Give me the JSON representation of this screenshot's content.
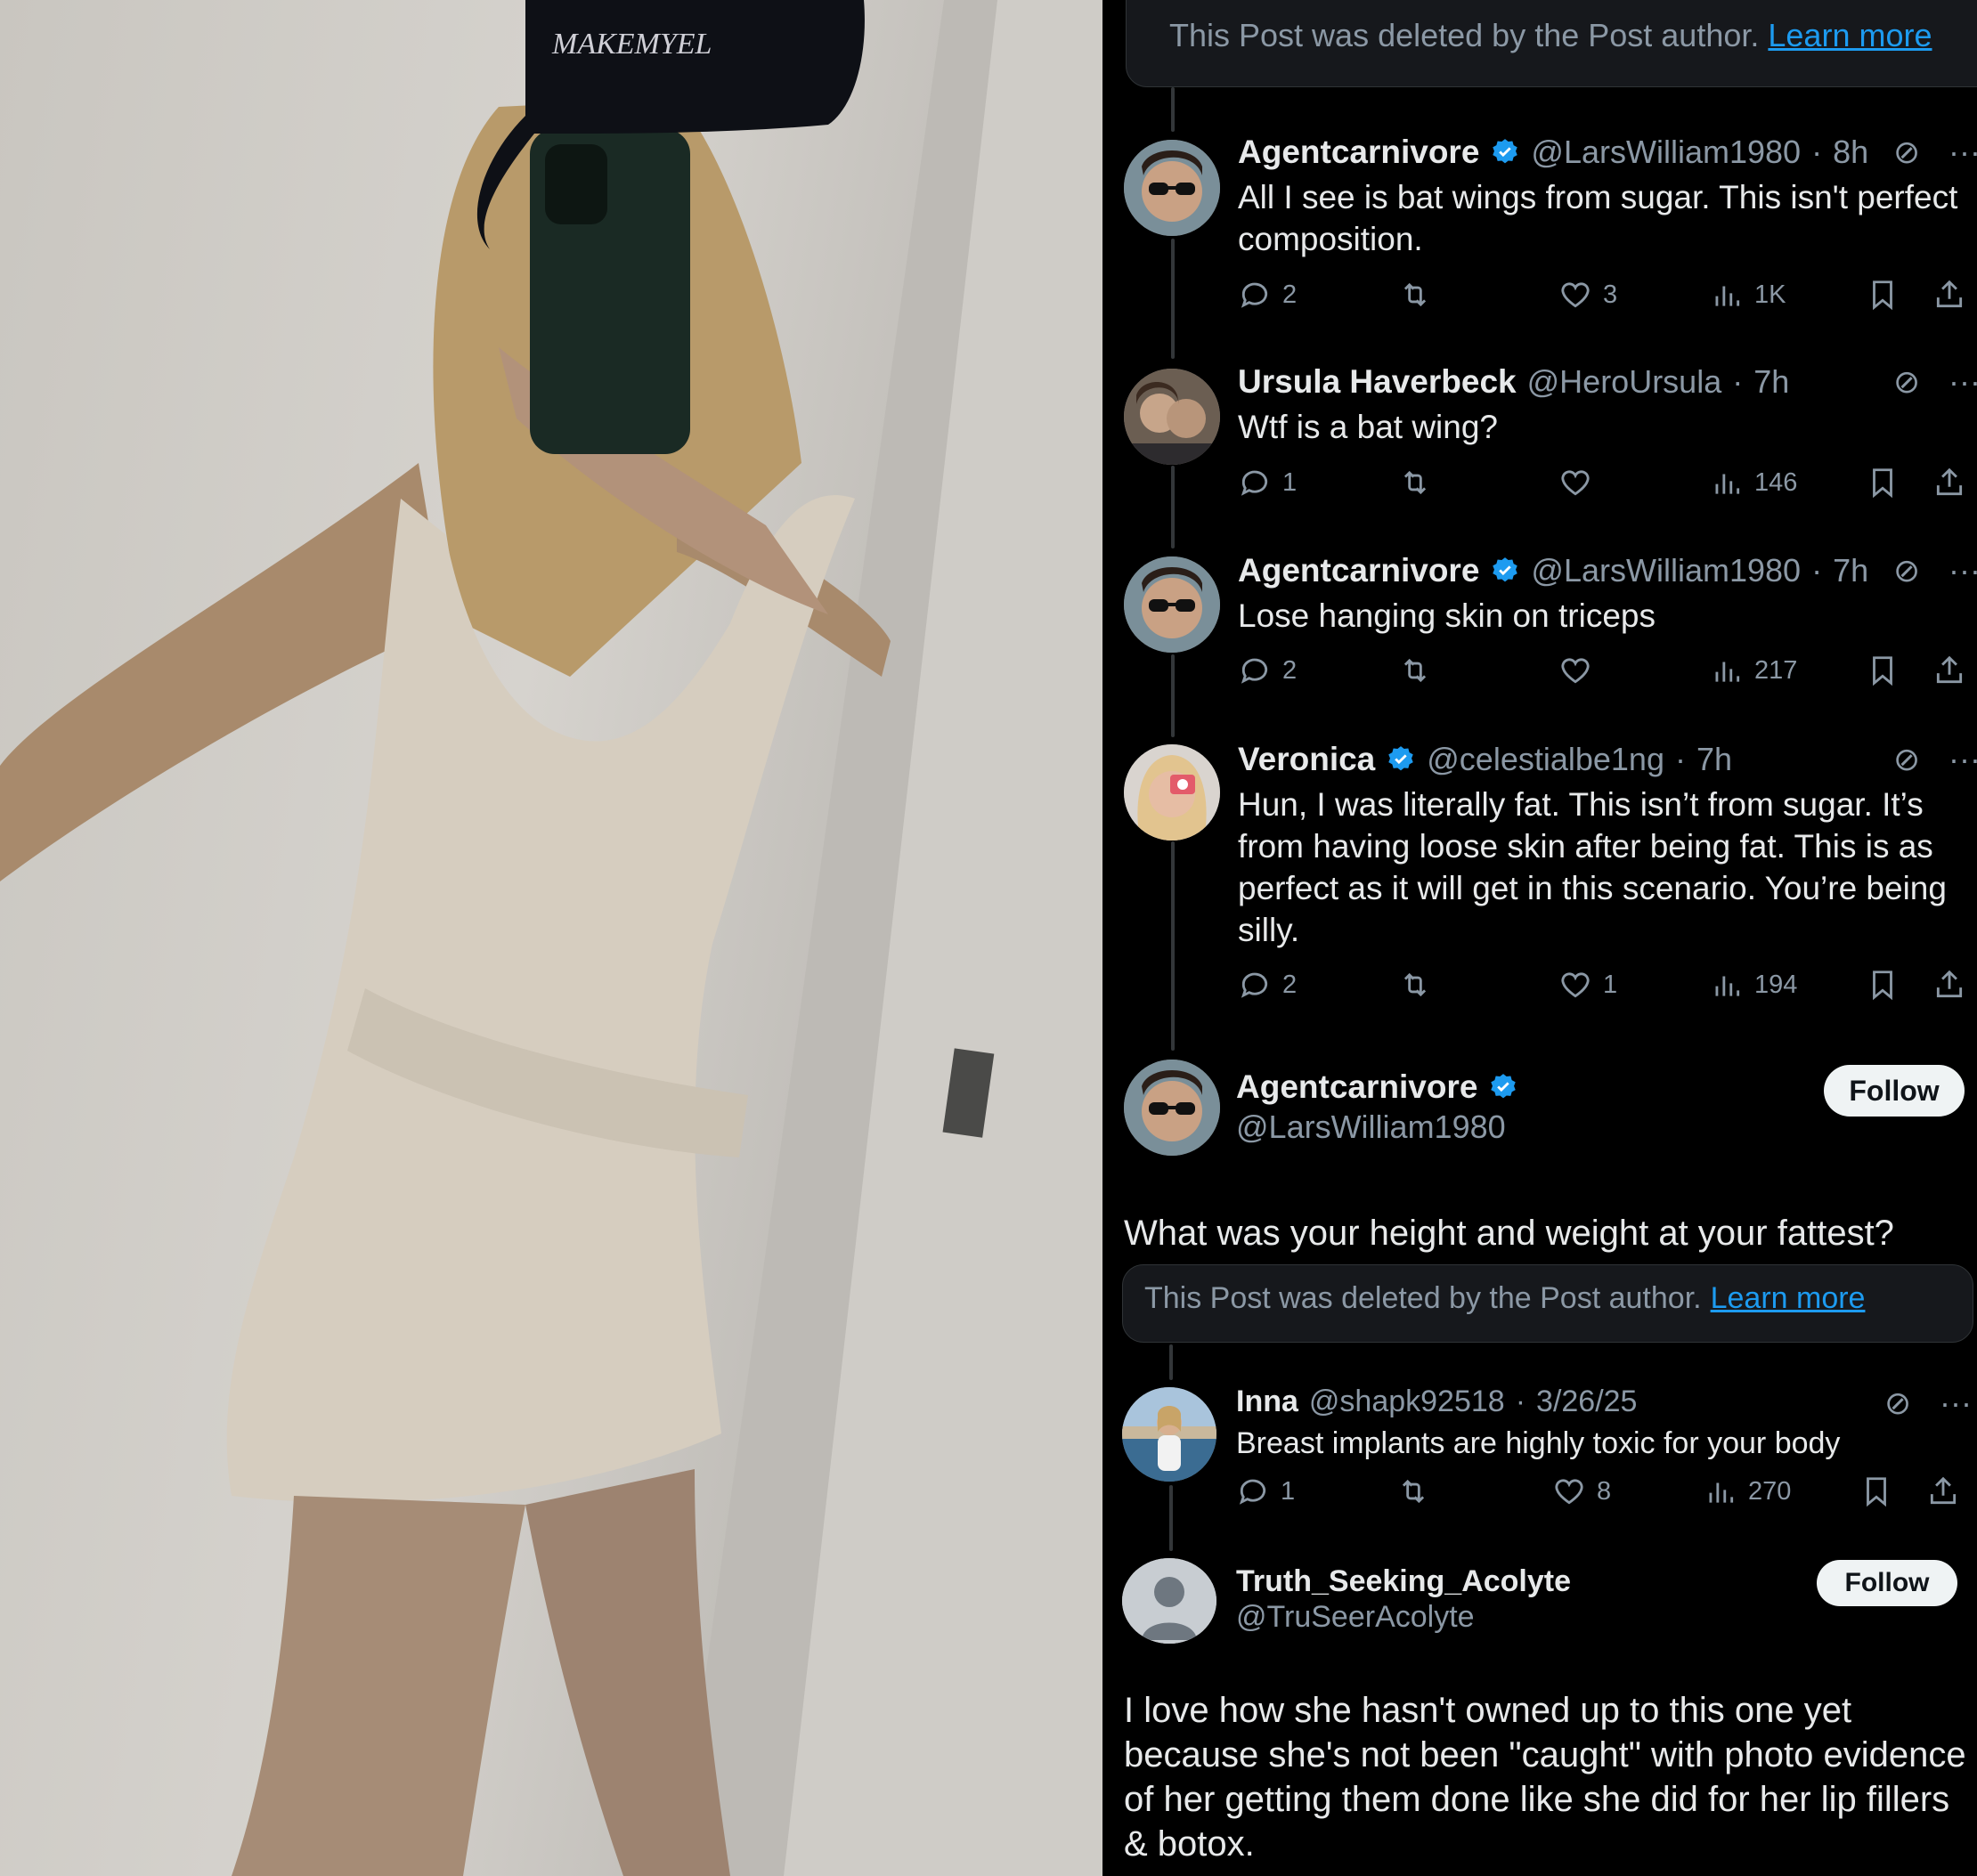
{
  "thread": {
    "deleted_notice_1": {
      "text": "This Post was deleted by the Post author.",
      "link": "Learn more"
    },
    "replies": [
      {
        "name": "Agentcarnivore",
        "handle": "@LarsWilliam1980",
        "time": "8h",
        "verified": true,
        "text": "All I see is bat wings from sugar. This isn't perfect composition.",
        "replies": "2",
        "reposts": "",
        "likes": "3",
        "views": "1K"
      },
      {
        "name": "Ursula Haverbeck",
        "handle": "@HeroUrsula",
        "time": "7h",
        "verified": false,
        "text": "Wtf is a bat wing?",
        "replies": "1",
        "reposts": "",
        "likes": "",
        "views": "146"
      },
      {
        "name": "Agentcarnivore",
        "handle": "@LarsWilliam1980",
        "time": "7h",
        "verified": true,
        "text": "Lose hanging skin on triceps",
        "replies": "2",
        "reposts": "",
        "likes": "",
        "views": "217"
      },
      {
        "name": "Veronica",
        "handle": "@celestialbe1ng",
        "time": "7h",
        "verified": true,
        "text": "Hun, I was literally fat. This isn’t from sugar. It’s from having loose skin after being fat. This is as perfect as it will get in this scenario. You’re being silly.",
        "replies": "2",
        "reposts": "",
        "likes": "1",
        "views": "194"
      }
    ],
    "focus_post": {
      "name": "Agentcarnivore",
      "handle": "@LarsWilliam1980",
      "follow_label": "Follow",
      "text": "What was your height and weight at your fattest?"
    },
    "deleted_notice_2": {
      "text": "This Post was deleted by the Post author.",
      "link": "Learn more"
    },
    "inna_reply": {
      "name": "Inna",
      "handle": "@shapk92518",
      "time": "3/26/25",
      "text": "Breast implants are highly toxic for your body",
      "replies": "1",
      "reposts": "",
      "likes": "8",
      "views": "270"
    },
    "last_post": {
      "name": "Truth_Seeking_Acolyte",
      "handle": "@TruSeerAcolyte",
      "follow_label": "Follow",
      "text": "I love how she hasn't owned up to this one yet because she's not been \"caught\" with photo evidence of her getting them done like she did for her lip fillers & botox."
    }
  },
  "icons": {
    "verified": "verified-badge-icon",
    "grok": "grok-icon",
    "more": "more-icon",
    "reply": "reply-icon",
    "repost": "repost-icon",
    "like": "like-icon",
    "views": "views-icon",
    "bookmark": "bookmark-icon",
    "share": "share-icon"
  },
  "colors": {
    "background": "#000000",
    "text": "#e7e9ea",
    "muted": "#8b98a5",
    "link": "#1d9bf0"
  }
}
